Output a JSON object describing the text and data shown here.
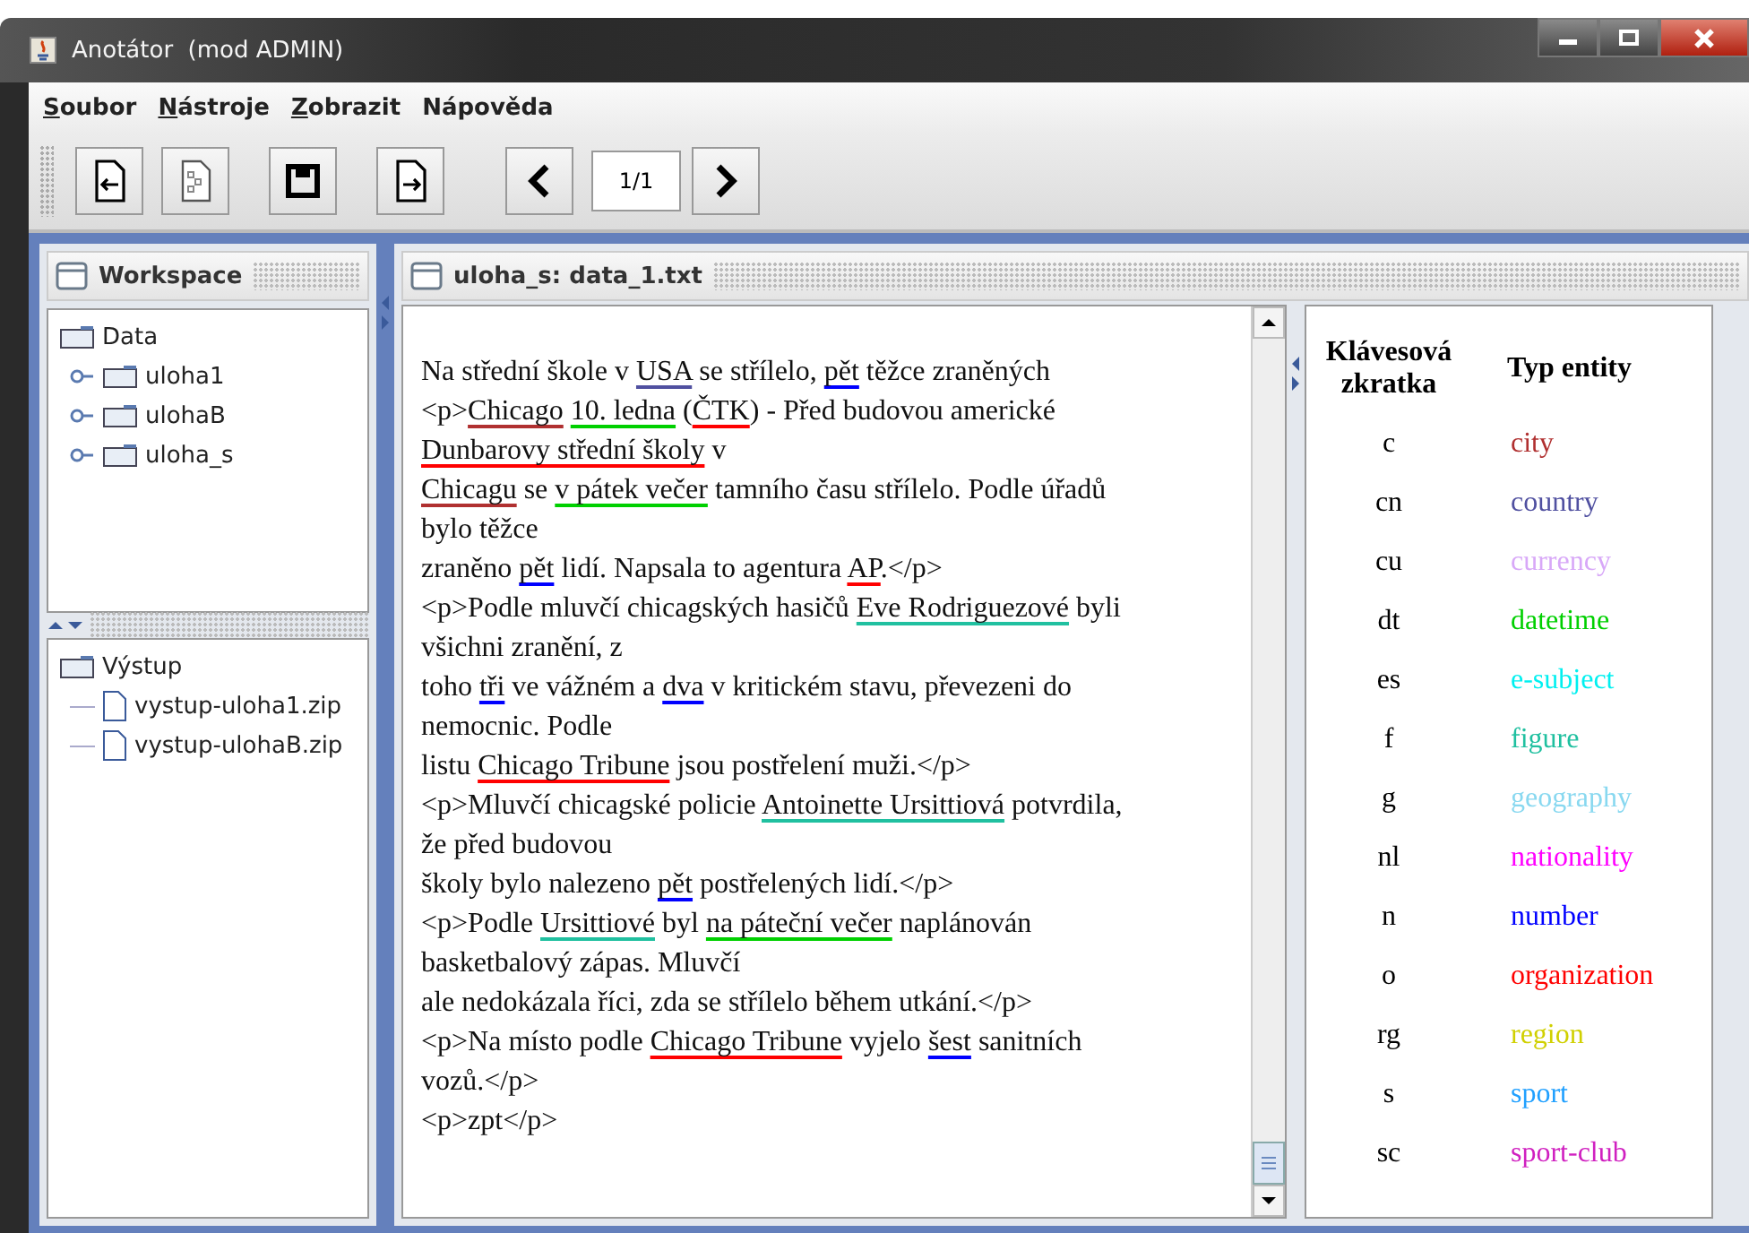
{
  "window": {
    "title": "Anotátor  (mod ADMIN)"
  },
  "menu": [
    {
      "label": "Soubor",
      "mnemonic": true
    },
    {
      "label": "Nástroje",
      "mnemonic": true
    },
    {
      "label": "Zobrazit",
      "mnemonic": true
    },
    {
      "label": "Nápověda",
      "mnemonic": false
    }
  ],
  "toolbar": {
    "page": "1/1"
  },
  "workspace": {
    "title": "Workspace",
    "data_tree": {
      "label": "Data",
      "children": [
        {
          "label": "uloha1"
        },
        {
          "label": "ulohaB"
        },
        {
          "label": "uloha_s"
        }
      ]
    },
    "output_tree": {
      "label": "Výstup",
      "children": [
        {
          "label": "vystup-uloha1.zip"
        },
        {
          "label": "vystup-ulohaB.zip"
        }
      ]
    }
  },
  "editor": {
    "title": "uloha_s: data_1.txt",
    "lines": [
      [
        {
          "text": "Na střední škole v "
        },
        {
          "text": "USA",
          "color": "#5050a0"
        },
        {
          "text": " se střílelo, "
        },
        {
          "text": "pět",
          "color": "#0000ff"
        },
        {
          "text": " těžce zraněných"
        }
      ],
      [
        {
          "text": "<p>"
        },
        {
          "text": "Chicago",
          "color": "#b03030"
        },
        {
          "text": "10. ledna",
          "color": "#00d000",
          "spaced": true
        },
        {
          "text": " ("
        },
        {
          "text": "ČTK",
          "color": "#ff0000"
        },
        {
          "text": ") - Před budovou americké"
        }
      ],
      [
        {
          "text": "Dunbarovy střední školy",
          "color": "#ff0000"
        },
        {
          "text": " v"
        }
      ],
      [
        {
          "text": "Chicagu",
          "color": "#b03030"
        },
        {
          "text": " se "
        },
        {
          "text": "v pátek večer",
          "color": "#00d000"
        },
        {
          "text": " tamního času střílelo. Podle úřadů"
        }
      ],
      [
        {
          "text": "bylo těžce"
        }
      ],
      [
        {
          "text": "zraněno "
        },
        {
          "text": "pět",
          "color": "#0000ff"
        },
        {
          "text": " lidí. Napsala to agentura "
        },
        {
          "text": "AP",
          "color": "#ff0000"
        },
        {
          "text": ".</p>"
        }
      ],
      [
        {
          "text": "<p>Podle mluvčí chicagských hasičů "
        },
        {
          "text": "Eve Rodriguezové",
          "color": "#20c0a0"
        },
        {
          "text": " byli"
        }
      ],
      [
        {
          "text": "všichni zranění, z"
        }
      ],
      [
        {
          "text": "toho "
        },
        {
          "text": "tři",
          "color": "#0000ff"
        },
        {
          "text": " ve vážném a "
        },
        {
          "text": "dva",
          "color": "#0000ff"
        },
        {
          "text": " v kritickém stavu, převezeni do"
        }
      ],
      [
        {
          "text": "nemocnic. Podle"
        }
      ],
      [
        {
          "text": "listu "
        },
        {
          "text": "Chicago Tribune",
          "color": "#ff0000"
        },
        {
          "text": " jsou postřelení muži.</p>"
        }
      ],
      [
        {
          "text": "<p>Mluvčí chicagské policie "
        },
        {
          "text": "Antoinette Ursittiová",
          "color": "#20c0a0"
        },
        {
          "text": " potvrdila,"
        }
      ],
      [
        {
          "text": "že před budovou"
        }
      ],
      [
        {
          "text": "školy bylo nalezeno "
        },
        {
          "text": "pět",
          "color": "#0000ff"
        },
        {
          "text": " postřelených lidí.</p>"
        }
      ],
      [
        {
          "text": "<p>Podle "
        },
        {
          "text": "Ursittiové",
          "color": "#20c0a0"
        },
        {
          "text": " byl "
        },
        {
          "text": "na páteční večer",
          "color": "#00d000"
        },
        {
          "text": " naplánován"
        }
      ],
      [
        {
          "text": "basketbalový zápas. Mluvčí"
        }
      ],
      [
        {
          "text": "ale nedokázala říci, zda se střílelo během utkání.</p>"
        }
      ],
      [
        {
          "text": "<p>Na místo podle "
        },
        {
          "text": "Chicago Tribune",
          "color": "#ff0000"
        },
        {
          "text": " vyjelo "
        },
        {
          "text": "šest",
          "color": "#0000ff"
        },
        {
          "text": " sanitních"
        }
      ],
      [
        {
          "text": "vozů.</p>"
        }
      ],
      [
        {
          "text": "<p>zpt</p>"
        }
      ]
    ]
  },
  "legend": {
    "columns": [
      "Klávesová zkratka",
      "Typ entity"
    ],
    "rows": [
      {
        "key": "c",
        "type": "city",
        "color": "#b03030"
      },
      {
        "key": "cn",
        "type": "country",
        "color": "#5050a0"
      },
      {
        "key": "cu",
        "type": "currency",
        "color": "#d8a8f8"
      },
      {
        "key": "dt",
        "type": "datetime",
        "color": "#00d000"
      },
      {
        "key": "es",
        "type": "e-subject",
        "color": "#00f0f0"
      },
      {
        "key": "f",
        "type": "figure",
        "color": "#20c0a0"
      },
      {
        "key": "g",
        "type": "geography",
        "color": "#88d8f0"
      },
      {
        "key": "nl",
        "type": "nationality",
        "color": "#ff00ff"
      },
      {
        "key": "n",
        "type": "number",
        "color": "#0000ff"
      },
      {
        "key": "o",
        "type": "organization",
        "color": "#ff0000"
      },
      {
        "key": "rg",
        "type": "region",
        "color": "#d0d000"
      },
      {
        "key": "s",
        "type": "sport",
        "color": "#20a0ff"
      },
      {
        "key": "sc",
        "type": "sport-club",
        "color": "#d020c0"
      }
    ]
  }
}
